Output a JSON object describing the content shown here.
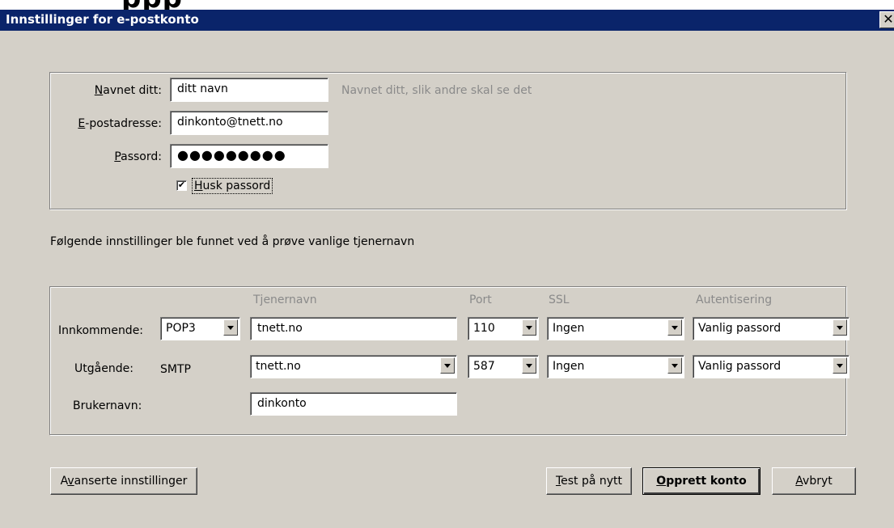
{
  "window": {
    "top_partial_text": "ppp",
    "title": "Innstillinger for e-postkonto",
    "close_glyph": "✕"
  },
  "account": {
    "name_label": "Navnet ditt:",
    "name_label_mnemonic": "N",
    "name_label_rest": "avnet ditt:",
    "name_value": "ditt navn",
    "name_hint": "Navnet ditt, slik andre skal se det",
    "email_label_mnemonic": "E",
    "email_label_rest": "-postadresse:",
    "email_value": "dinkonto@tnett.no",
    "password_label_mnemonic": "P",
    "password_label_rest": "assord:",
    "password_value": "●●●●●●●●●",
    "remember_checked": true,
    "remember_check_glyph": "✔",
    "remember_label_mnemonic": "H",
    "remember_label_rest": "usk passord"
  },
  "found_message": "Følgende innstillinger ble funnet ved å prøve vanlige tjenernavn",
  "server": {
    "headers": {
      "hostname": "Tjenernavn",
      "port": "Port",
      "ssl": "SSL",
      "auth": "Autentisering"
    },
    "incoming": {
      "label": "Innkommende:",
      "protocol": "POP3",
      "hostname": "tnett.no",
      "port": "110",
      "ssl": "Ingen",
      "auth": "Vanlig passord"
    },
    "outgoing": {
      "label": "Utgående:",
      "protocol": "SMTP",
      "hostname": "tnett.no",
      "port": "587",
      "ssl": "Ingen",
      "auth": "Vanlig passord"
    },
    "username_label": "Brukernavn:",
    "username_value": "dinkonto"
  },
  "buttons": {
    "advanced_pre": "A",
    "advanced_mnemonic": "v",
    "advanced_rest": "anserte innstillinger",
    "retest_mnemonic": "T",
    "retest_rest": "est på nytt",
    "create_mnemonic": "O",
    "create_rest": "pprett konto",
    "cancel_mnemonic": "A",
    "cancel_rest": "vbryt"
  }
}
